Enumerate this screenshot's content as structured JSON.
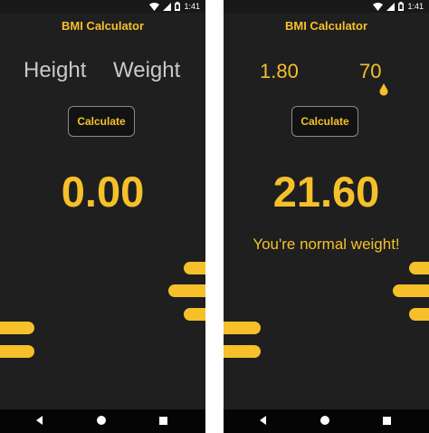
{
  "app": {
    "title": "BMI Calculator"
  },
  "status_bar": {
    "time": "1:41"
  },
  "left_screen": {
    "height_hint": "Height",
    "weight_hint": "Weight",
    "calculate_label": "Calculate",
    "bmi_value": "0.00"
  },
  "right_screen": {
    "height_value": "1.80",
    "weight_value": "70",
    "calculate_label": "Calculate",
    "bmi_value": "21.60",
    "status_message": "You're normal weight!"
  },
  "colors": {
    "accent": "#f5c02a",
    "background": "#1f1f1f",
    "hint_text": "#c9c9c9",
    "nav_bar": "#050505"
  },
  "icons": [
    "wifi-icon",
    "signal-icon",
    "battery-icon",
    "nav-back-icon",
    "nav-home-icon",
    "nav-recent-icon"
  ]
}
